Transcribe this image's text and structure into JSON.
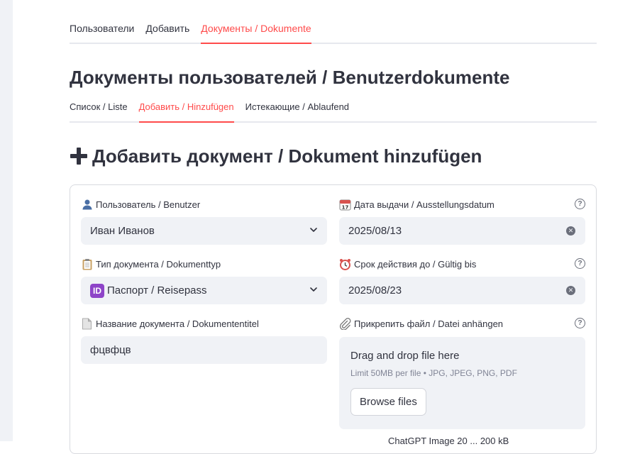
{
  "top_tabs": [
    {
      "label": "Пользователи"
    },
    {
      "label": "Добавить"
    },
    {
      "label": "Документы / Dokumente",
      "active": true
    }
  ],
  "page_title": "Документы пользователей / Benutzerdokumente",
  "sub_tabs": [
    {
      "label": "Список / Liste"
    },
    {
      "label": "Добавить / Hinzufügen",
      "active": true
    },
    {
      "label": "Истекающие / Ablaufend"
    }
  ],
  "section_title": "Добавить документ / Dokument hinzufügen",
  "form": {
    "user": {
      "label": "Пользователь / Benutzer",
      "icon": "user-silhouette-icon",
      "value": "Иван Иванов"
    },
    "doc_type": {
      "label": "Тип документа / Dokumenttyp",
      "icon": "clipboard-icon",
      "value": "Паспорт / Reisepass",
      "value_icon": "ID"
    },
    "doc_title": {
      "label": "Название документа / Dokumententitel",
      "icon": "document-page-icon",
      "value": "фцвфцв"
    },
    "issue_date": {
      "label": "Дата выдачи / Ausstellungsdatum",
      "icon": "calendar-icon",
      "value": "2025/08/13"
    },
    "valid_until": {
      "label": "Срок действия до / Gültig bis",
      "icon": "alarm-clock-icon",
      "value": "2025/08/23"
    },
    "attachment": {
      "label": "Прикрепить файл / Datei anhängen",
      "icon": "paperclip-icon",
      "drop_title": "Drag and drop file here",
      "drop_sub": "Limit 50MB per file • JPG, JPEG, PNG, PDF",
      "browse_label": "Browse files"
    },
    "partial_text": "ChatGPT Image 20 ... 200 kB"
  },
  "colors": {
    "accent": "#ff4b4b",
    "input_bg": "#f0f2f6",
    "text": "#31333f"
  }
}
